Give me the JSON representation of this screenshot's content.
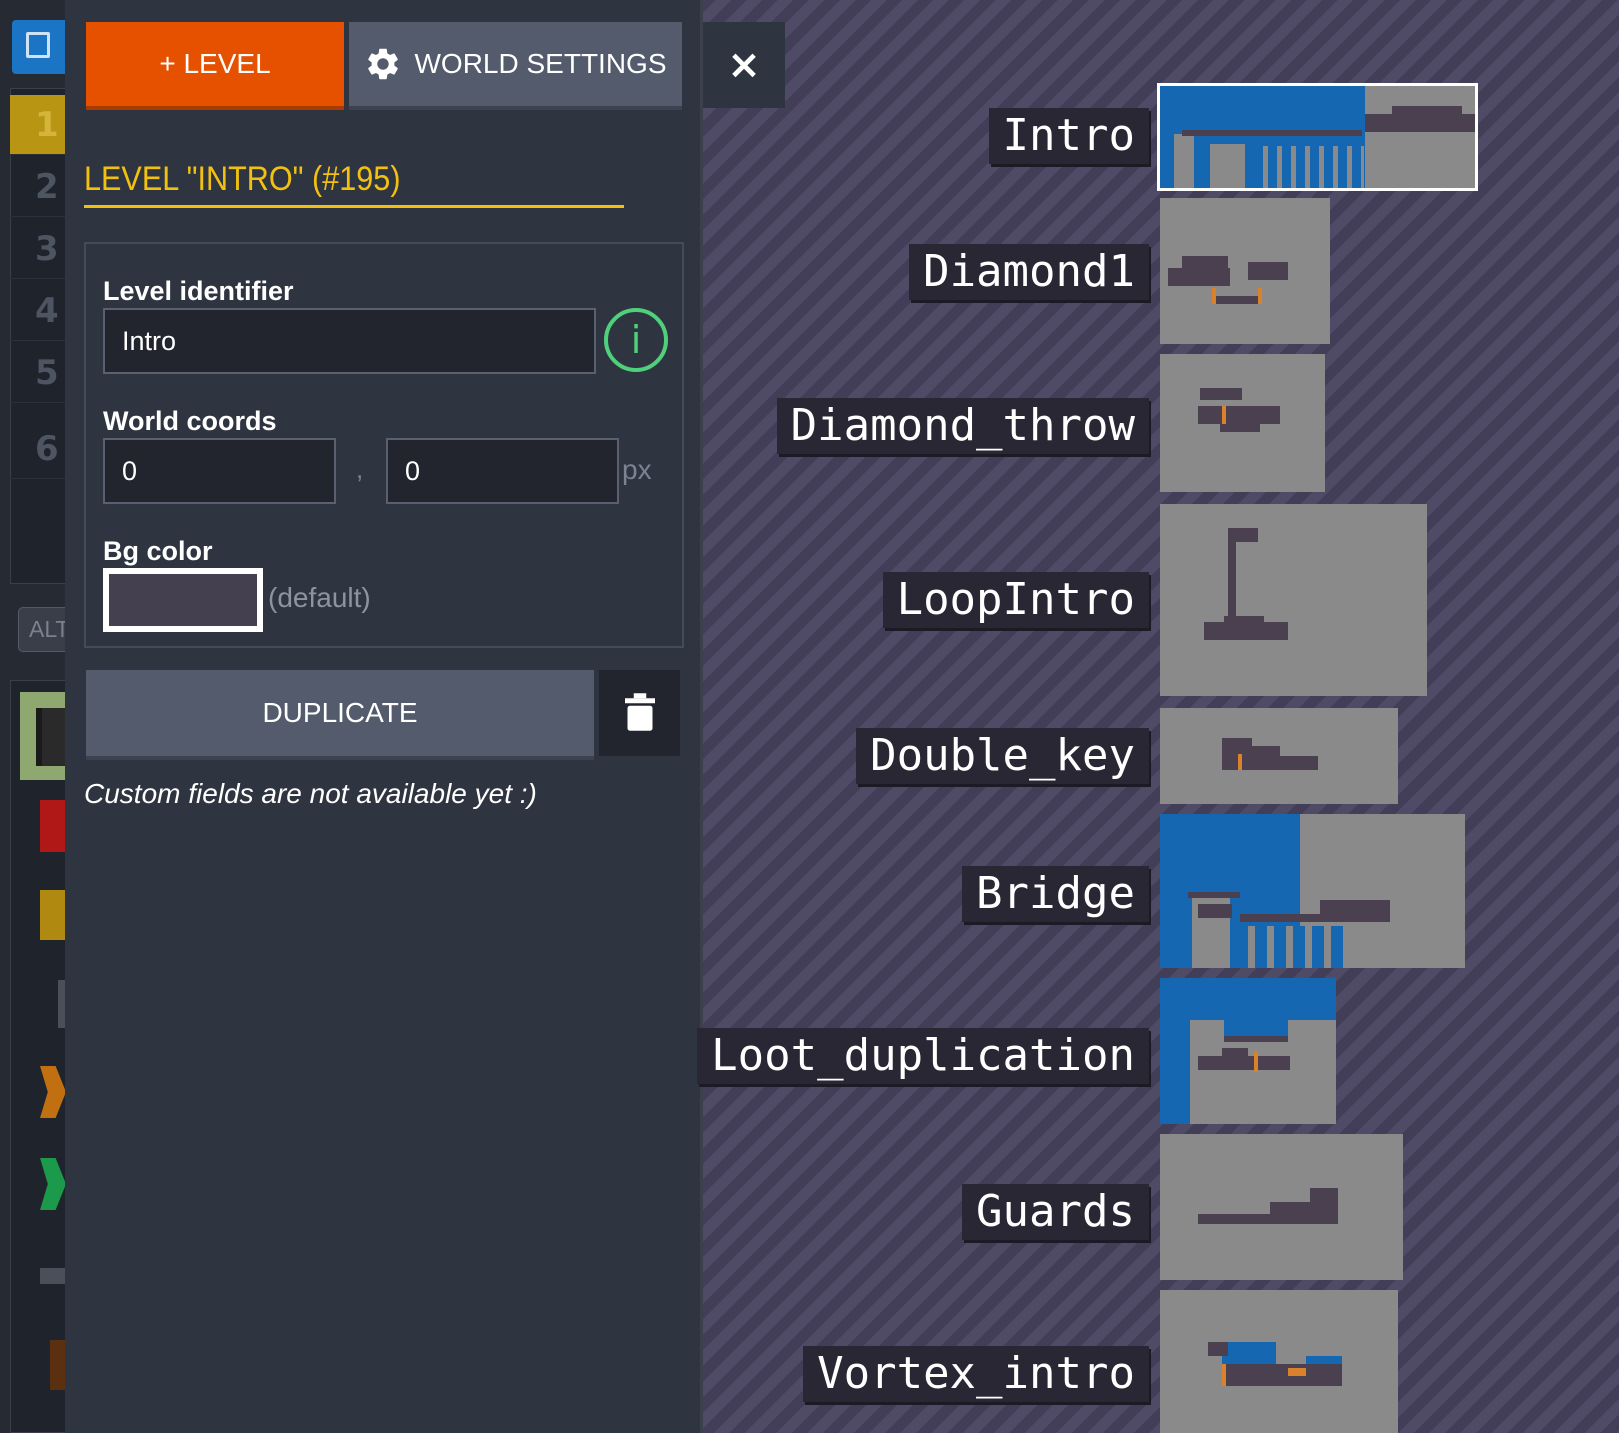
{
  "toolbar": {
    "add_level_label": "+ LEVEL",
    "world_settings_label": "WORLD SETTINGS",
    "close_label": "×"
  },
  "sidebar": {
    "layer_numbers": [
      "1",
      "2",
      "3",
      "4",
      "5",
      "6"
    ],
    "alt_label": "ALT"
  },
  "level_panel": {
    "title": "LEVEL \"INTRO\" (#195)",
    "identifier_label": "Level identifier",
    "identifier_value": "Intro",
    "info_icon_glyph": "i",
    "world_coords_label": "World coords",
    "coord_x": "0",
    "coord_y": "0",
    "coord_separator": ",",
    "coord_unit": "px",
    "bg_color_label": "Bg color",
    "bg_color_value": "#45404f",
    "bg_color_note": "(default)",
    "duplicate_label": "DUPLICATE",
    "custom_fields_note": "Custom fields are not available yet :)"
  },
  "world_map": {
    "levels": [
      {
        "name": "Intro",
        "selected": true
      },
      {
        "name": "Diamond1",
        "selected": false
      },
      {
        "name": "Diamond_throw",
        "selected": false
      },
      {
        "name": "LoopIntro",
        "selected": false
      },
      {
        "name": "Double_key",
        "selected": false
      },
      {
        "name": "Bridge",
        "selected": false
      },
      {
        "name": "Loot_duplication",
        "selected": false
      },
      {
        "name": "Guards",
        "selected": false
      },
      {
        "name": "Vortex_intro",
        "selected": false
      }
    ]
  },
  "colors": {
    "accent_orange": "#e65100",
    "title_yellow": "#f2c10f",
    "info_green": "#4fd07a",
    "water_blue": "#1467b0",
    "panel_bg": "#2f3441"
  }
}
